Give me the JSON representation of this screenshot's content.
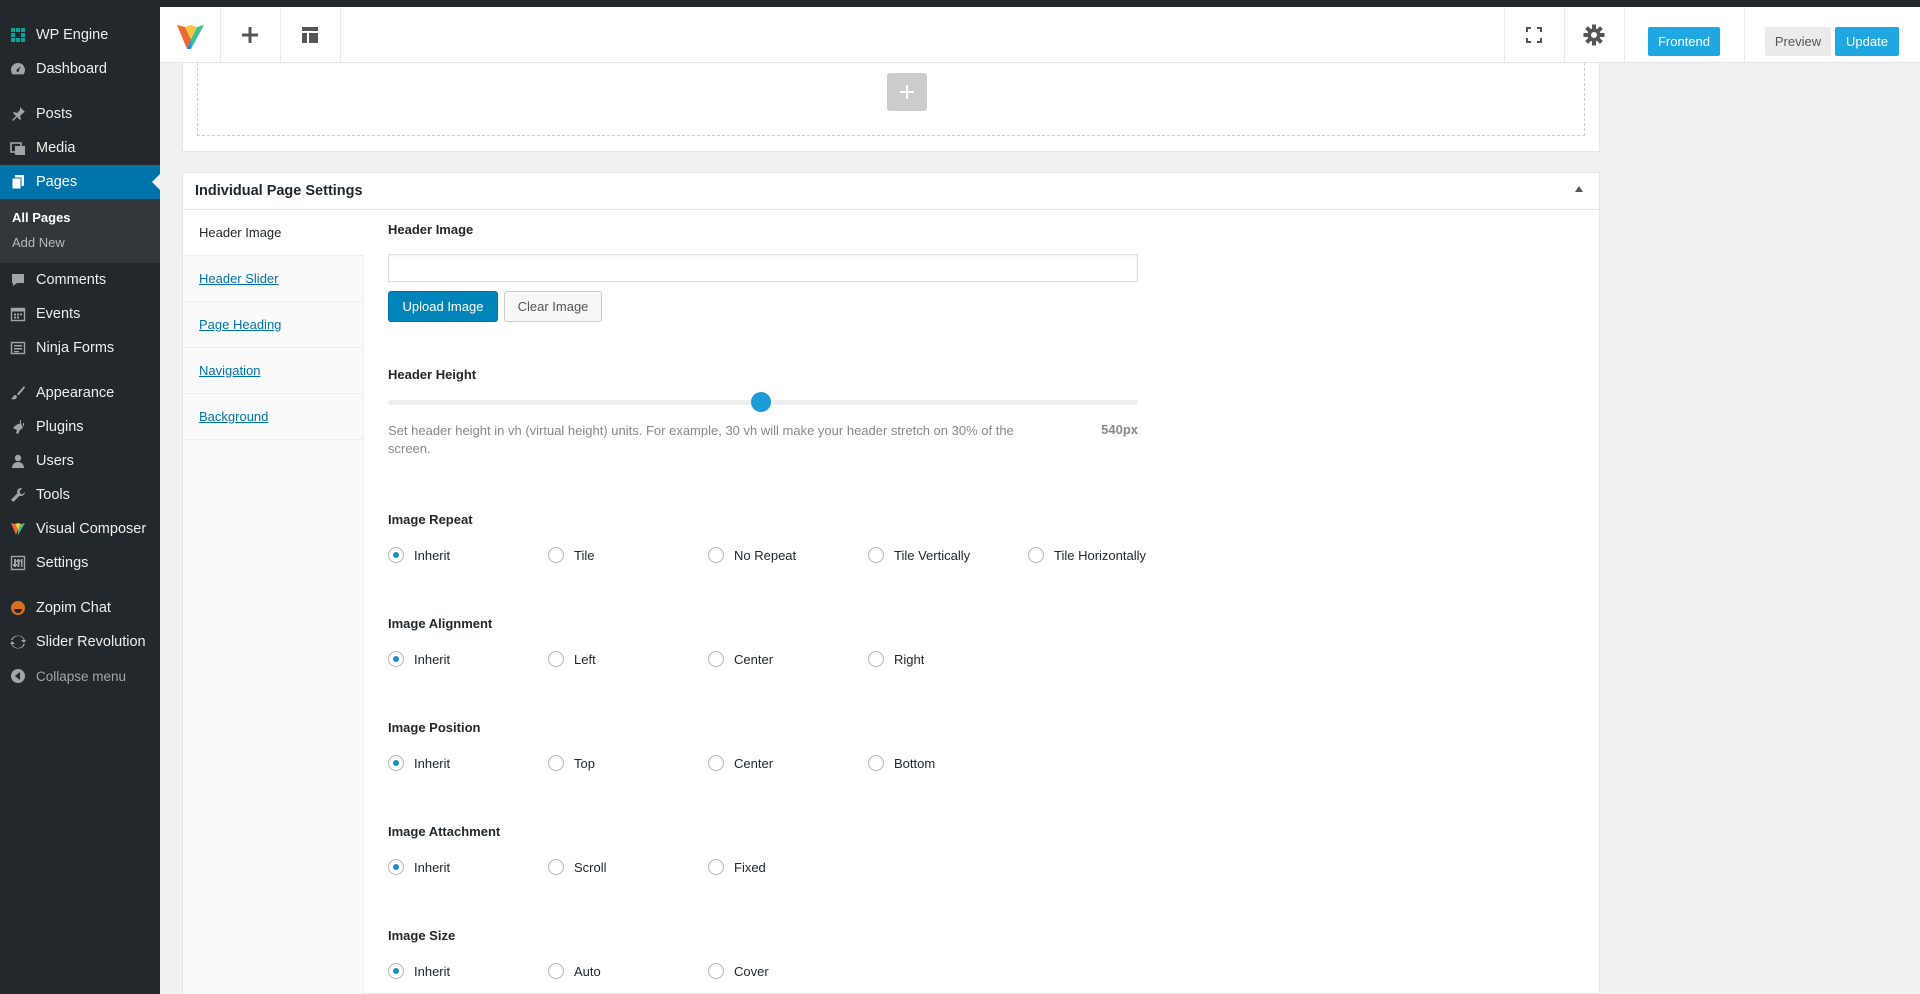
{
  "sidebar": {
    "items": [
      {
        "label": "WP Engine",
        "icon": "wp-engine-icon"
      },
      {
        "label": "Dashboard",
        "icon": "dashboard-icon"
      },
      {
        "label": "Posts",
        "icon": "pin-icon"
      },
      {
        "label": "Media",
        "icon": "media-icon"
      },
      {
        "label": "Pages",
        "icon": "pages-icon"
      },
      {
        "label": "Comments",
        "icon": "comment-icon"
      },
      {
        "label": "Events",
        "icon": "calendar-icon"
      },
      {
        "label": "Ninja Forms",
        "icon": "forms-icon"
      },
      {
        "label": "Appearance",
        "icon": "brush-icon"
      },
      {
        "label": "Plugins",
        "icon": "plug-icon"
      },
      {
        "label": "Users",
        "icon": "user-icon"
      },
      {
        "label": "Tools",
        "icon": "wrench-icon"
      },
      {
        "label": "Visual Composer",
        "icon": "visual-composer-icon"
      },
      {
        "label": "Settings",
        "icon": "settings-icon"
      },
      {
        "label": "Zopim Chat",
        "icon": "zopim-icon"
      },
      {
        "label": "Slider Revolution",
        "icon": "refresh-icon"
      }
    ],
    "submenu": [
      "All Pages",
      "Add New"
    ],
    "collapse_label": "Collapse menu"
  },
  "toolbar": {
    "frontend_label": "Frontend",
    "preview_label": "Preview",
    "update_label": "Update"
  },
  "settings": {
    "title": "Individual Page Settings",
    "tabs": [
      "Header Image",
      "Header Slider",
      "Page Heading",
      "Navigation",
      "Background"
    ],
    "header_image": {
      "title": "Header Image",
      "value": "",
      "upload_label": "Upload Image",
      "clear_label": "Clear Image"
    },
    "header_height": {
      "title": "Header Height",
      "fraction": 0.497,
      "hint": "Set header height in vh (virtual height) units. For example, 30 vh will make your header stretch on 30% of the screen.",
      "value_label": "540px"
    },
    "groups": [
      {
        "title": "Image Repeat",
        "options": [
          "Inherit",
          "Tile",
          "No Repeat",
          "Tile Vertically",
          "Tile Horizontally"
        ],
        "selected": 0
      },
      {
        "title": "Image Alignment",
        "options": [
          "Inherit",
          "Left",
          "Center",
          "Right"
        ],
        "selected": 0
      },
      {
        "title": "Image Position",
        "options": [
          "Inherit",
          "Top",
          "Center",
          "Bottom"
        ],
        "selected": 0
      },
      {
        "title": "Image Attachment",
        "options": [
          "Inherit",
          "Scroll",
          "Fixed"
        ],
        "selected": 0
      },
      {
        "title": "Image Size",
        "options": [
          "Inherit",
          "Auto",
          "Cover"
        ],
        "selected": 0
      }
    ]
  },
  "colors": {
    "accent": "#1e9ad6",
    "sidebar_bg": "#23282d",
    "active_menu": "#0073aa"
  }
}
